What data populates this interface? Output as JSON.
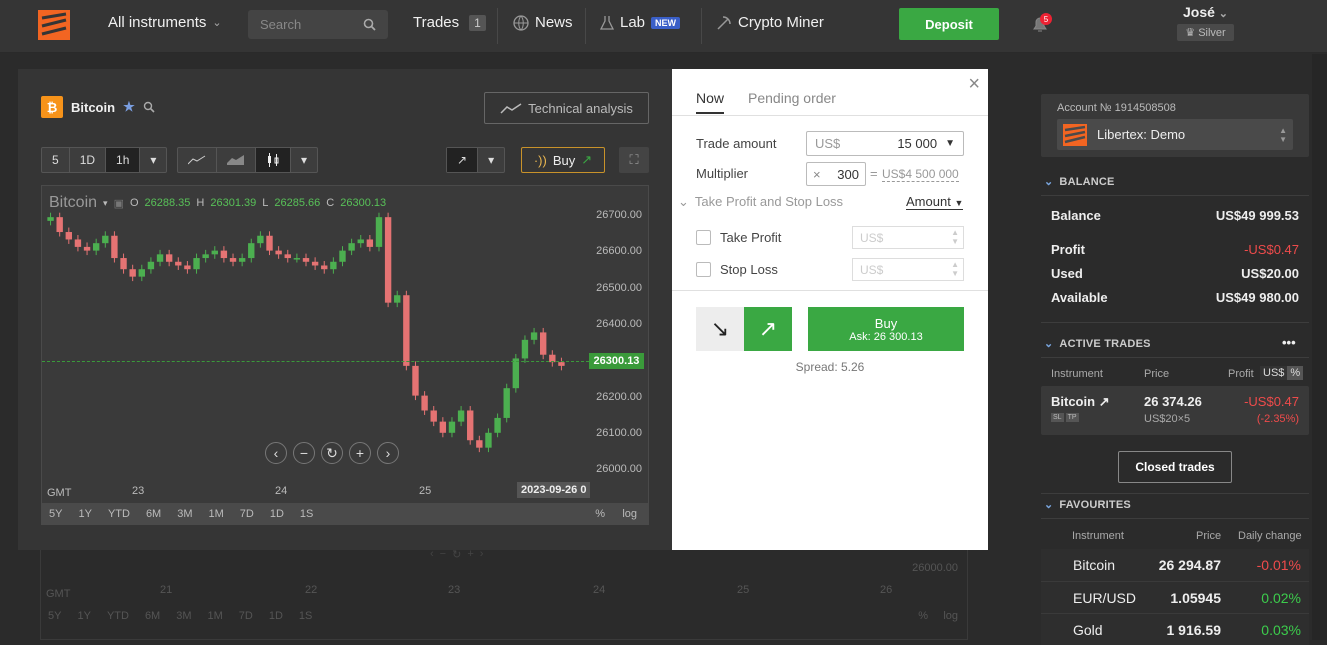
{
  "topbar": {
    "instruments": "All instruments",
    "search_placeholder": "Search",
    "trades": "Trades",
    "trades_count": "1",
    "news": "News",
    "lab": "Lab",
    "lab_badge": "NEW",
    "crypto": "Crypto Miner",
    "deposit": "Deposit",
    "notif_count": "5",
    "user_name": "José",
    "user_tier": "Silver"
  },
  "chart": {
    "symbol": "Bitcoin",
    "technical": "Technical analysis",
    "periods": [
      "5",
      "1D",
      "1h"
    ],
    "buy": "Buy",
    "plot_symbol": "Bitcoin",
    "ohlc": {
      "o_lbl": "O",
      "o": "26288.35",
      "h_lbl": "H",
      "h": "26301.39",
      "l_lbl": "L",
      "l": "26285.66",
      "c_lbl": "C",
      "c": "26300.13"
    },
    "y_ticks": [
      "26700.00",
      "26600.00",
      "26500.00",
      "26400.00",
      "26200.00",
      "26100.00",
      "26000.00"
    ],
    "current_price": "26300.13",
    "gmt": "GMT",
    "x_ticks": [
      "23",
      "24",
      "25"
    ],
    "cur_date": "2023-09-26 0",
    "ranges": [
      "5Y",
      "1Y",
      "YTD",
      "6M",
      "3M",
      "1M",
      "7D",
      "1D",
      "1S"
    ],
    "pct": "%",
    "log": "log"
  },
  "chart_data": {
    "type": "candlestick",
    "title": "Bitcoin",
    "ylim": [
      25950,
      26730
    ],
    "x_ticks": [
      "23",
      "24",
      "25"
    ],
    "series": [
      {
        "name": "Bitcoin",
        "close": [
          26700,
          26660,
          26640,
          26620,
          26610,
          26630,
          26650,
          26590,
          26560,
          26540,
          26560,
          26580,
          26600,
          26580,
          26570,
          26560,
          26590,
          26600,
          26610,
          26590,
          26580,
          26590,
          26630,
          26650,
          26610,
          26600,
          26590,
          26590,
          26580,
          26570,
          26560,
          26580,
          26610,
          26630,
          26640,
          26620,
          26700,
          26470,
          26490,
          26300,
          26220,
          26180,
          26150,
          26120,
          26150,
          26180,
          26100,
          26080,
          26120,
          26160,
          26240,
          26320,
          26370,
          26390,
          26330,
          26310,
          26300
        ]
      }
    ]
  },
  "order": {
    "tab_now": "Now",
    "tab_pending": "Pending order",
    "trade_amount": "Trade amount",
    "currency": "US$",
    "amount": "15 000",
    "multiplier": "Multiplier",
    "mult_x": "×",
    "mult_val": "300",
    "mult_eq": "=",
    "mult_total": "US$4 500 000",
    "tpsl": "Take Profit and Stop Loss",
    "amount_sel": "Amount",
    "take_profit": "Take Profit",
    "stop_loss": "Stop Loss",
    "tp_ph": "US$",
    "sl_ph": "US$",
    "buy": "Buy",
    "ask": "Ask: 26 300.13",
    "spread": "Spread: 5.26"
  },
  "sidebar": {
    "account_no": "Account № 1914508508",
    "account_name": "Libertex: Demo",
    "balance_sec": "BALANCE",
    "balance_lbl": "Balance",
    "balance": "US$49 999.53",
    "profit_lbl": "Profit",
    "profit": "-US$0.47",
    "used_lbl": "Used",
    "used": "US$20.00",
    "avail_lbl": "Available",
    "avail": "US$49 980.00",
    "active_sec": "ACTIVE TRADES",
    "more": "•••",
    "h_instr": "Instrument",
    "h_price": "Price",
    "h_profit": "Profit",
    "h_us": "US$",
    "h_pct": "%",
    "t_name": "Bitcoin",
    "t_price": "26 374.26",
    "t_profit": "-US$0.47",
    "t_sub": "US$20×5",
    "t_pct": "(-2.35%)",
    "t_sl": "SL",
    "t_tp": "TP",
    "closed": "Closed trades",
    "fav_sec": "FAVOURITES",
    "f_instr": "Instrument",
    "f_price": "Price",
    "f_change": "Daily change",
    "favs": [
      {
        "name": "Bitcoin",
        "price": "26 294.87",
        "change": "-0.01%"
      },
      {
        "name": "EUR/USD",
        "price": "1.05945",
        "change": "0.02%"
      },
      {
        "name": "Gold",
        "price": "1 916.59",
        "change": "0.03%"
      }
    ]
  },
  "bg": {
    "gmt": "GMT",
    "ticks": [
      "21",
      "22",
      "23",
      "24",
      "25",
      "26"
    ],
    "price": "26000.00",
    "ranges": [
      "5Y",
      "1Y",
      "YTD",
      "6M",
      "3M",
      "1M",
      "7D",
      "1D",
      "1S"
    ],
    "pct": "%",
    "log": "log"
  },
  "colors": {
    "accent": "#3aa843",
    "up": "#4caf50",
    "down": "#e57373",
    "brand": "#f26522"
  }
}
